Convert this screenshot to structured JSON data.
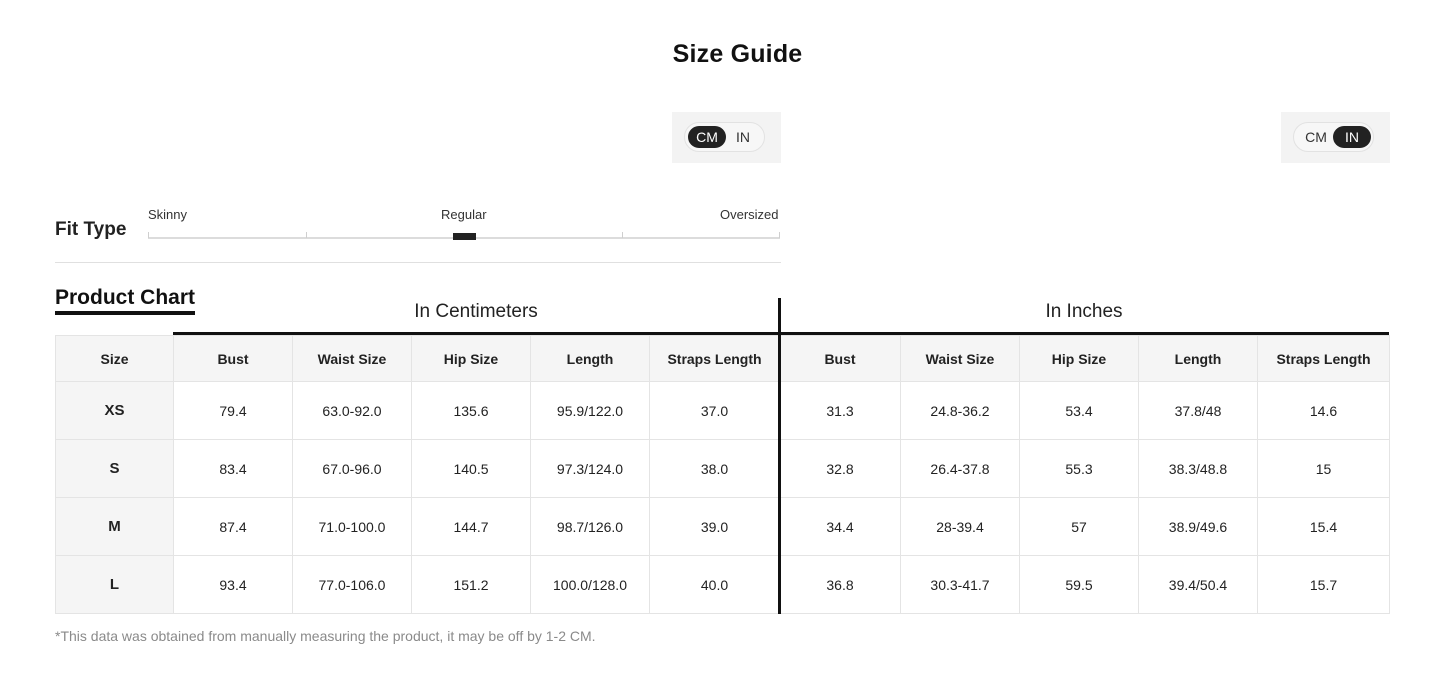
{
  "page": {
    "title": "Size Guide",
    "footnote": "*This data was obtained from manually measuring the product, it may be off by 1-2 CM."
  },
  "unit_toggle_left": {
    "options": [
      "CM",
      "IN"
    ],
    "selected": "CM"
  },
  "unit_toggle_right": {
    "options": [
      "CM",
      "IN"
    ],
    "selected": "IN"
  },
  "fit_type": {
    "label": "Fit Type",
    "scale": [
      "Skinny",
      "Regular",
      "Oversized"
    ],
    "selected": "Regular"
  },
  "product_chart": {
    "heading": "Product Chart",
    "groups": [
      "In Centimeters",
      "In Inches"
    ],
    "columns": [
      "Size",
      "Bust",
      "Waist Size",
      "Hip Size",
      "Length",
      "Straps Length",
      "Bust",
      "Waist Size",
      "Hip Size",
      "Length",
      "Straps Length"
    ],
    "rows": [
      [
        "XS",
        "79.4",
        "63.0-92.0",
        "135.6",
        "95.9/122.0",
        "37.0",
        "31.3",
        "24.8-36.2",
        "53.4",
        "37.8/48",
        "14.6"
      ],
      [
        "S",
        "83.4",
        "67.0-96.0",
        "140.5",
        "97.3/124.0",
        "38.0",
        "32.8",
        "26.4-37.8",
        "55.3",
        "38.3/48.8",
        "15"
      ],
      [
        "M",
        "87.4",
        "71.0-100.0",
        "144.7",
        "98.7/126.0",
        "39.0",
        "34.4",
        "28-39.4",
        "57",
        "38.9/49.6",
        "15.4"
      ],
      [
        "L",
        "93.4",
        "77.0-106.0",
        "151.2",
        "100.0/128.0",
        "40.0",
        "36.8",
        "30.3-41.7",
        "59.5",
        "39.4/50.4",
        "15.7"
      ]
    ]
  }
}
